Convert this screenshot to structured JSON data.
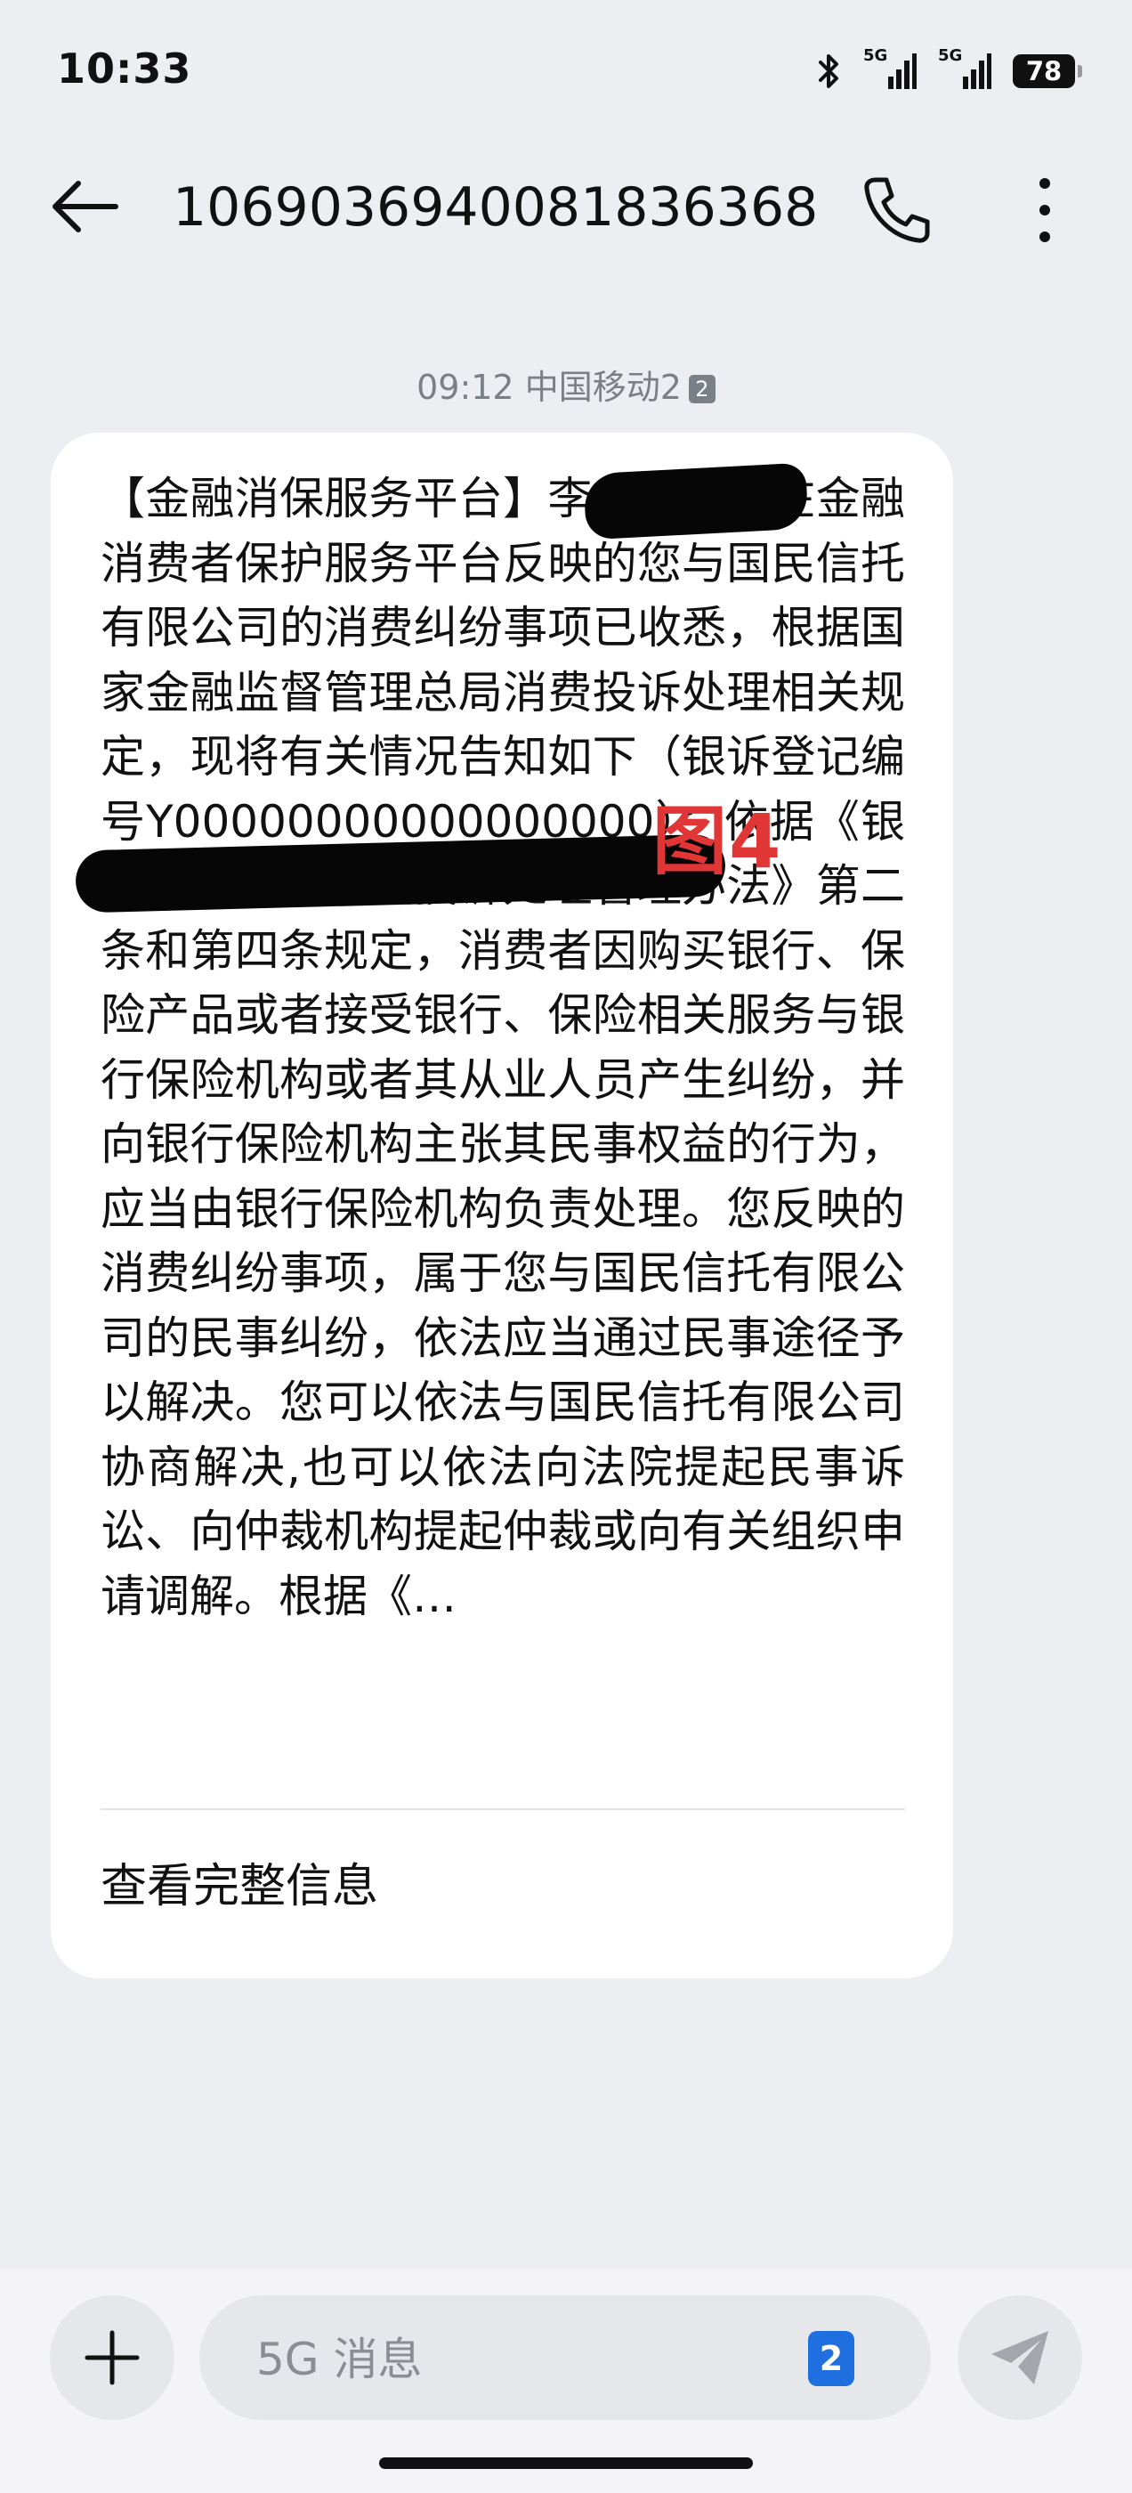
{
  "status_bar": {
    "time": "10:33",
    "icons": [
      "bluetooth-icon",
      "signal-5g-icon",
      "signal-5g-icon"
    ],
    "sim1_network": "5G",
    "sim2_network": "5G",
    "battery": "78"
  },
  "header": {
    "back_icon": "arrow-left-icon",
    "title": "1069036940081836368",
    "call_icon": "phone-icon",
    "more_icon": "more-vertical-icon"
  },
  "message": {
    "time": "09:12",
    "carrier": "中国移动2",
    "sim_badge": "2",
    "body": "【金融消保服务平台】李先生，您在金融消费者保护服务平台反映的您与国民信托有限公司的消费纠纷事项已收悉，根据国家金融监督管理总局消费投诉处理相关规定，现将有关情况告知如下（银诉登记编号Y00000000000000000）：依据《银行业保险业消费投诉处理管理办法》第二条和第四条规定，消费者因购买银行、保险产品或者接受银行、保险相关服务与银行保险机构或者其从业人员产生纠纷，并向银行保险机构主张其民事权益的行为，应当由银行保险机构负责处理。您反映的消费纠纷事项，属于您与国民信托有限公司的民事纠纷，依法应当通过民事途径予以解决。您可以依法与国民信托有限公司协商解决,也可以依法向法院提起民事诉讼、向仲裁机构提起仲裁或向有关组织申请调解。根据《…",
    "annotation": "图4",
    "view_full": "查看完整信息"
  },
  "composer": {
    "add_icon": "plus-icon",
    "placeholder": "5G 消息",
    "sim_select": "2",
    "send_icon": "send-icon"
  },
  "colors": {
    "background": "#eceef2",
    "bubble": "#ffffff",
    "accent_blue": "#1f6fe0",
    "annotation_red": "#e03636"
  }
}
